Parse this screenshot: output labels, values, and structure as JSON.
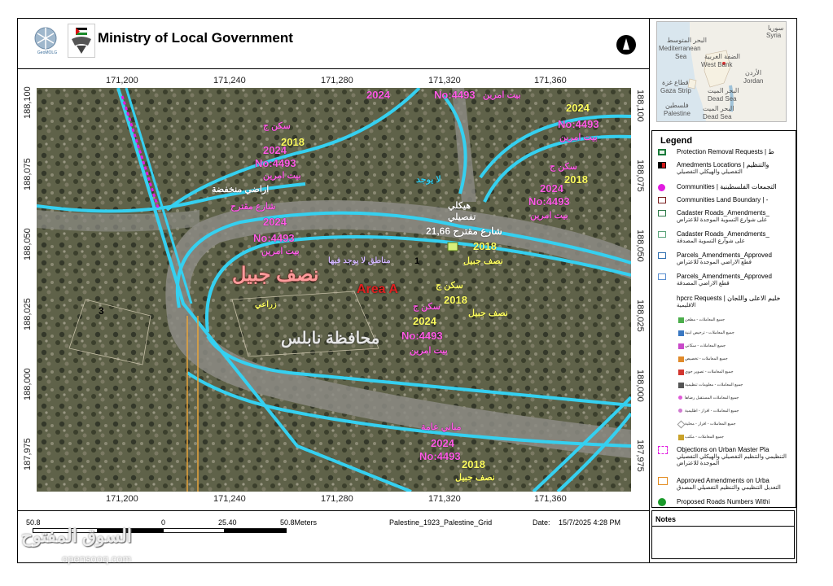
{
  "header": {
    "title": "Ministry of Local Government",
    "geomolg_logo_text": "GeoMOLG"
  },
  "inset_map": {
    "labels": [
      {
        "text": "سوريا",
        "key": "syria_ar"
      },
      {
        "text": "Syria",
        "key": "syria"
      },
      {
        "text": "البحر المتوسط",
        "key": "med_ar"
      },
      {
        "text": "Mediterranean",
        "key": "med1"
      },
      {
        "text": "Sea",
        "key": "med2"
      },
      {
        "text": "الضفة الغربية",
        "key": "wb_ar"
      },
      {
        "text": "West Bank",
        "key": "wb"
      },
      {
        "text": "الأردن",
        "key": "jordan_ar"
      },
      {
        "text": "Jordan",
        "key": "jordan"
      },
      {
        "text": "قطاع غزة",
        "key": "gaza_ar"
      },
      {
        "text": "Gaza Strip",
        "key": "gaza"
      },
      {
        "text": "البحر الميت",
        "key": "ds_ar"
      },
      {
        "text": "Dead Sea",
        "key": "ds"
      },
      {
        "text": "فلسطين",
        "key": "pal_ar"
      },
      {
        "text": "Palestine",
        "key": "pal"
      },
      {
        "text": "البحر الميت",
        "key": "ds2_ar"
      },
      {
        "text": "Dead Sea",
        "key": "ds2"
      }
    ]
  },
  "grid": {
    "x_ticks": [
      "171,200",
      "171,240",
      "171,280",
      "171,320",
      "171,360"
    ],
    "y_ticks": [
      "188,100",
      "188,075",
      "188,050",
      "188,025",
      "188,000",
      "187,975"
    ]
  },
  "map_labels": {
    "naseef_jbeel": "نصف جبيل",
    "area_a": "Area A",
    "nablus_gov": "محافظة نابلس",
    "no4493": "No:4493",
    "year2024": "2024",
    "year2018": "2018",
    "sakan_j": "سكن ج",
    "bayt_imrin": "بيت امرين",
    "naseef_jbeel_small": "نصف جبيل",
    "arad_munkhafida": "اراضي منخفضة",
    "shari_muqtarah": "شارع مقترح",
    "street_2166": "شارع مقترح 21,66",
    "haykal": "هيكلي",
    "tafsili": "تفصيلي",
    "la_yujad": "لا يوجد",
    "mabani_amma": "مباني عامة",
    "manatiq": "مناطق لا يوجد فيها",
    "khadra": "زراعي",
    "num3": "3",
    "num1": "1"
  },
  "legend": {
    "title": "Legend",
    "items": [
      {
        "en": "Protection Removal Requests | ط",
        "ar": "",
        "color": "#1a7a3a",
        "shape": "box-solid"
      },
      {
        "en": "Amedments Locations | والتنظيم",
        "ar": "التفصيلي والهيكلي التفصيلي",
        "color": "#d11a1a",
        "shape": "box-red"
      },
      {
        "en": "Communities | التجمعات الفلسطينية",
        "ar": "",
        "color": "#e11be0",
        "shape": "dot"
      },
      {
        "en": "Communities Land Boundary | -",
        "ar": "",
        "color": "#7a1f1f",
        "shape": "box-outline"
      },
      {
        "en": "Cadaster Roads_Amendments_",
        "ar": "على شوارع التسوية الموجدة للاعتراض",
        "color": "#2e7a48",
        "shape": "box-outline"
      },
      {
        "en": "Cadaster Roads_Amendments_",
        "ar": "على شوارع التسوية المصدقة",
        "color": "#5aa37a",
        "shape": "box-outline"
      },
      {
        "en": "Parcels_Amendments_Approved",
        "ar": "قطع الاراضي الموجدة للاعتراض",
        "color": "#2f6fb0",
        "shape": "box-outline"
      },
      {
        "en": "Parcels_Amendments_Approved",
        "ar": "قطع الاراضي المصدقة",
        "color": "#5a8fd0",
        "shape": "box-outline"
      },
      {
        "en": "hpcrc Requests | خليم الاعلى واللجان",
        "ar": "الاقليمية",
        "color": "#ffffff",
        "shape": "none"
      }
    ],
    "sub_items": [
      {
        "text": "جميع المعاملات - مطعن",
        "color": "#4cae4c"
      },
      {
        "text": "جميع المعاملات - ترخيص ابنية",
        "color": "#3a78c2"
      },
      {
        "text": "جميع المعاملات - سكاني",
        "color": "#c94ac9"
      },
      {
        "text": "جميع المعاملات - تخصيص",
        "color": "#e08a2a"
      },
      {
        "text": "جميع المعاملات - تصوير جوي",
        "color": "#d2362f"
      },
      {
        "text": "جميع المعاملات - معلومات تنظيمية",
        "color": "#555555"
      },
      {
        "text": "جميع المعاملات المستقبل رضاها",
        "color": "#e05ad8"
      },
      {
        "text": "جميع المعاملات - افراز - اظليمية",
        "color": "#d07ad0"
      },
      {
        "text": "جميع المعاملات - افراز - محلية",
        "color": "#999999"
      },
      {
        "text": "جميع المعاملات - مكتب",
        "color": "#c9a22a"
      }
    ],
    "bottom_items": [
      {
        "en": "Objections on Urban Master Pla",
        "ar": "التنظيمي والتنظيم التفصيلي والهيكلي التفصيلي الموجدة للاعتراض",
        "color": "#e11be0",
        "shape": "dashed"
      },
      {
        "en": "Approved Amendments on Urba",
        "ar": "التعديل التنظيمي والتنظيم التفصيلي المصدق",
        "color": "#e38b1e",
        "shape": "box-outline"
      },
      {
        "en": "Proposed Roads Numbers Withi",
        "ar": "",
        "color": "#1a9a2a",
        "shape": "circle-plus"
      }
    ]
  },
  "notes": {
    "title": "Notes"
  },
  "scale": {
    "left": "50.8",
    "zero": "0",
    "mid": "25.40",
    "right": "50.8Meters"
  },
  "footer": {
    "projection": "Palestine_1923_Palestine_Grid",
    "date_label": "Date:",
    "date_value": "15/7/2025 4:28 PM"
  },
  "watermark": {
    "line1": "السوق المفتوح",
    "line2": "opensooq.com"
  }
}
